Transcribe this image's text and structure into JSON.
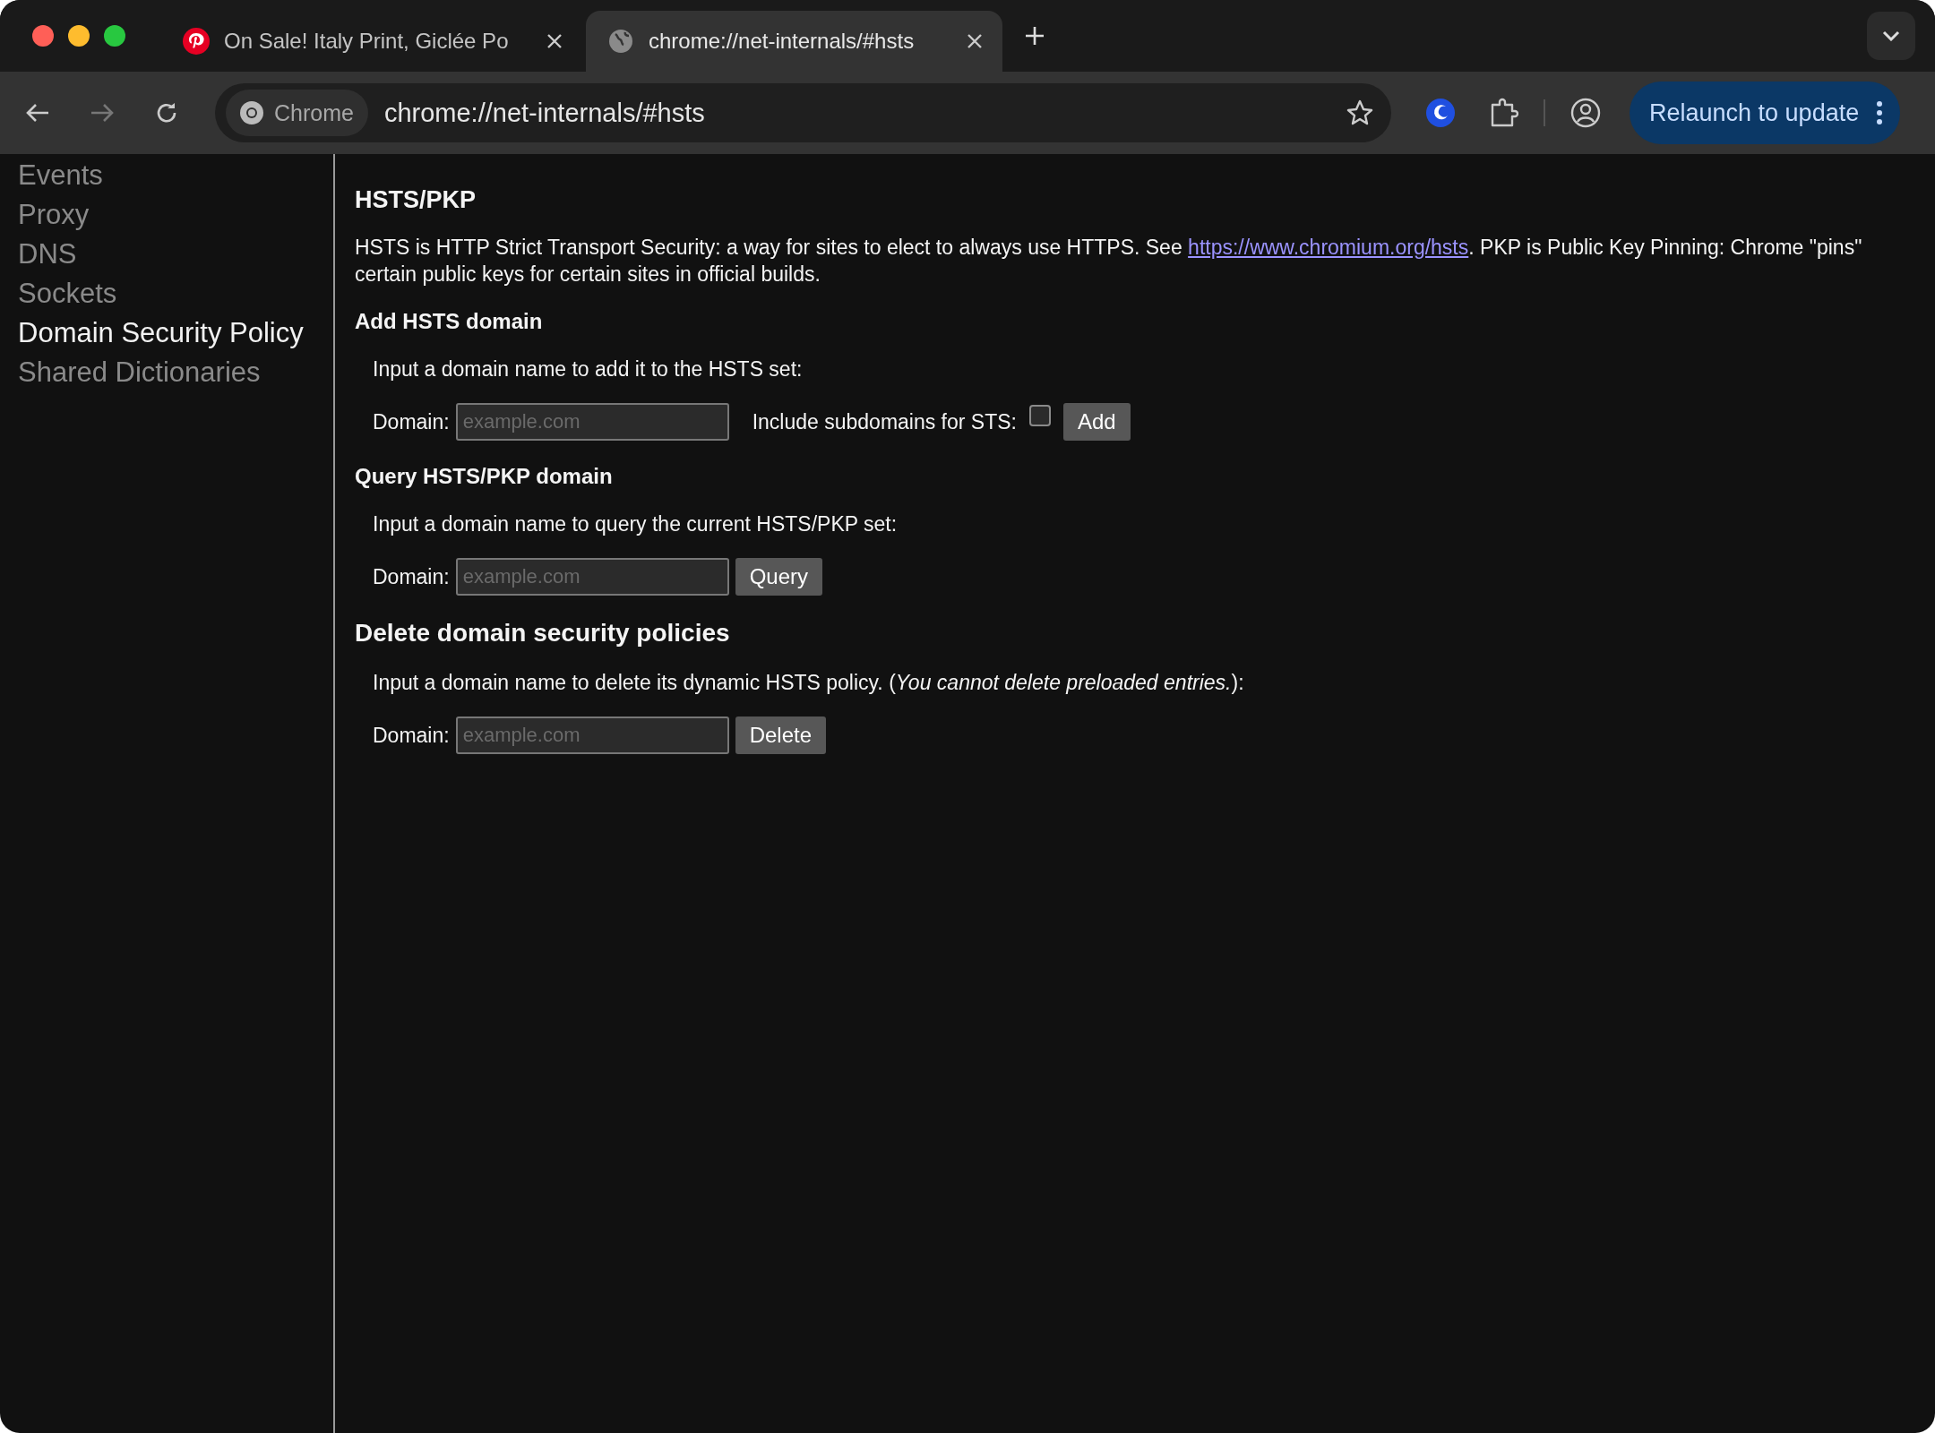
{
  "tabs": [
    {
      "title": "On Sale! Italy Print, Giclée Po",
      "selected": false
    },
    {
      "title": "chrome://net-internals/#hsts",
      "selected": true
    }
  ],
  "toolbar": {
    "chip": "Chrome",
    "url": "chrome://net-internals/#hsts",
    "relaunch": "Relaunch to update"
  },
  "sidebar": {
    "items": [
      {
        "label": "Events",
        "selected": false
      },
      {
        "label": "Proxy",
        "selected": false
      },
      {
        "label": "DNS",
        "selected": false
      },
      {
        "label": "Sockets",
        "selected": false
      },
      {
        "label": "Domain Security Policy",
        "selected": true
      },
      {
        "label": "Shared Dictionaries",
        "selected": false
      }
    ]
  },
  "main": {
    "title": "HSTS/PKP",
    "intro": {
      "before": "HSTS is HTTP Strict Transport Security: a way for sites to elect to always use HTTPS. See ",
      "link": "https://www.chromium.org/hsts",
      "after": ". PKP is Public Key Pinning: Chrome \"pins\" certain public keys for certain sites in official builds."
    },
    "sections": [
      {
        "kind": "minor",
        "heading": "Add HSTS domain",
        "instruction": "Input a domain name to add it to the HSTS set:",
        "field_label": "Domain:",
        "placeholder": "example.com",
        "checkbox": {
          "label": "Include subdomains for STS:",
          "checked": false
        },
        "button": "Add"
      },
      {
        "kind": "minor",
        "heading": "Query HSTS/PKP domain",
        "instruction": "Input a domain name to query the current HSTS/PKP set:",
        "field_label": "Domain:",
        "placeholder": "example.com",
        "button": "Query"
      },
      {
        "kind": "major",
        "heading": "Delete domain security policies",
        "instruction": "Input a domain name to delete its dynamic HSTS policy. (*You cannot delete preloaded entries.*):",
        "field_label": "Domain:",
        "placeholder": "example.com",
        "button": "Delete"
      }
    ]
  }
}
